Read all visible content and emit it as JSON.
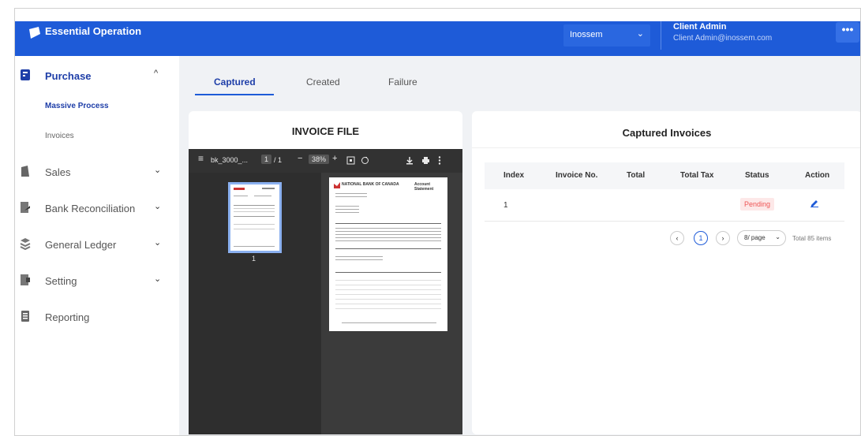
{
  "header": {
    "app_title": "Essential Operation",
    "company": "Inossem",
    "user_name": "Client Admin",
    "user_email": "Client Admin@inossem.com",
    "more": "•••",
    "brand_color": "#1e5bd8"
  },
  "sidebar": {
    "items": [
      {
        "label": "Purchase",
        "icon": "cart-icon",
        "chevron": "^"
      },
      {
        "label": "Sales",
        "icon": "sales-icon",
        "chevron": "⌄"
      },
      {
        "label": "Bank Reconciliation",
        "icon": "bank-icon",
        "chevron": "⌄"
      },
      {
        "label": "General Ledger",
        "icon": "ledger-icon",
        "chevron": "⌄"
      },
      {
        "label": "Setting",
        "icon": "setting-icon",
        "chevron": "⌄"
      },
      {
        "label": "Reporting",
        "icon": "report-icon"
      }
    ],
    "sub_items": [
      {
        "label": "Massive Process",
        "active": true
      },
      {
        "label": "Invoices",
        "active": false
      }
    ]
  },
  "tabs": [
    {
      "label": "Captured",
      "active": true
    },
    {
      "label": "Created",
      "active": false
    },
    {
      "label": "Failure",
      "active": false
    }
  ],
  "invoice_file": {
    "title": "INVOICE FILE",
    "pdf": {
      "menu": "≡",
      "filename": "bk_3000_...",
      "page_current": "1",
      "page_sep": "/ 1",
      "minus": "−",
      "zoom": "38%",
      "plus": "+",
      "thumb_label": "1",
      "doc_bank": "NATIONAL BANK OF CANADA",
      "doc_heading": "Account Statement"
    }
  },
  "captured_invoices": {
    "title": "Captured Invoices",
    "columns": [
      "Index",
      "Invoice No.",
      "Total",
      "Total Tax",
      "Status",
      "Action"
    ],
    "rows": [
      {
        "index": "1",
        "invoice_no": "",
        "total": "",
        "total_tax": "",
        "status": "Pending",
        "action_icon": "edit-icon"
      }
    ],
    "pagination": {
      "prev": "‹",
      "current_page": "1",
      "next": "›",
      "page_size": "8/ page",
      "total_text": "Total 85 items"
    }
  }
}
